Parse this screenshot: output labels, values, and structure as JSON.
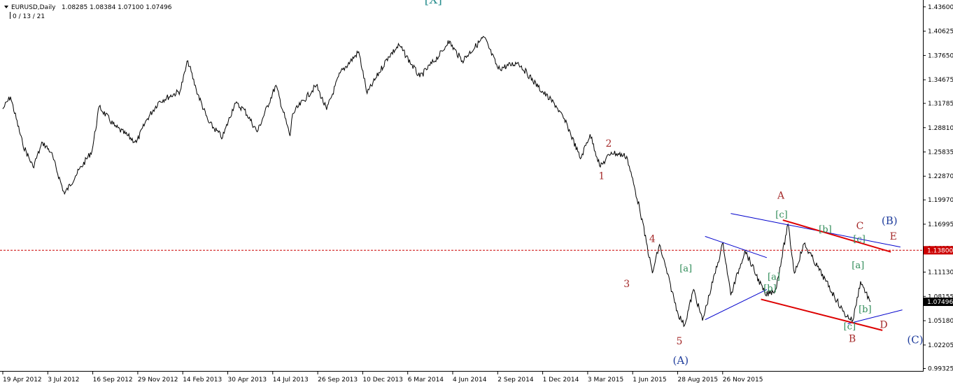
{
  "header": {
    "symbol": "EURUSD,Daily",
    "ohlc": "1.08285 1.08384 1.07100 1.07496",
    "counter": "0 / 13 / 21"
  },
  "chart_data": {
    "type": "line",
    "series": [
      {
        "values": [
          {
            "d": "2012-04-19",
            "v": 1.311
          },
          {
            "d": "2012-05-01",
            "v": 1.326
          },
          {
            "d": "2012-05-20",
            "v": 1.268
          },
          {
            "d": "2012-06-05",
            "v": 1.24
          },
          {
            "d": "2012-06-20",
            "v": 1.27
          },
          {
            "d": "2012-07-03",
            "v": 1.258
          },
          {
            "d": "2012-07-24",
            "v": 1.207
          },
          {
            "d": "2012-08-10",
            "v": 1.229
          },
          {
            "d": "2012-09-05",
            "v": 1.26
          },
          {
            "d": "2012-09-16",
            "v": 1.314
          },
          {
            "d": "2012-10-10",
            "v": 1.29
          },
          {
            "d": "2012-11-13",
            "v": 1.27
          },
          {
            "d": "2012-11-29",
            "v": 1.298
          },
          {
            "d": "2012-12-18",
            "v": 1.32
          },
          {
            "d": "2013-01-20",
            "v": 1.333
          },
          {
            "d": "2013-02-01",
            "v": 1.37
          },
          {
            "d": "2013-02-14",
            "v": 1.335
          },
          {
            "d": "2013-03-05",
            "v": 1.295
          },
          {
            "d": "2013-03-27",
            "v": 1.276
          },
          {
            "d": "2013-04-15",
            "v": 1.318
          },
          {
            "d": "2013-04-30",
            "v": 1.31
          },
          {
            "d": "2013-05-20",
            "v": 1.283
          },
          {
            "d": "2013-06-18",
            "v": 1.34
          },
          {
            "d": "2013-07-10",
            "v": 1.278
          },
          {
            "d": "2013-07-14",
            "v": 1.305
          },
          {
            "d": "2013-08-20",
            "v": 1.34
          },
          {
            "d": "2013-09-05",
            "v": 1.31
          },
          {
            "d": "2013-09-26",
            "v": 1.355
          },
          {
            "d": "2013-10-25",
            "v": 1.381
          },
          {
            "d": "2013-11-07",
            "v": 1.33
          },
          {
            "d": "2013-12-10",
            "v": 1.375
          },
          {
            "d": "2013-12-27",
            "v": 1.389
          },
          {
            "d": "2014-01-28",
            "v": 1.35
          },
          {
            "d": "2014-03-06",
            "v": 1.383
          },
          {
            "d": "2014-03-13",
            "v": 1.395
          },
          {
            "d": "2014-04-04",
            "v": 1.37
          },
          {
            "d": "2014-05-08",
            "v": 1.399
          },
          {
            "d": "2014-05-30",
            "v": 1.36
          },
          {
            "d": "2014-06-30",
            "v": 1.368
          },
          {
            "d": "2014-07-31",
            "v": 1.338
          },
          {
            "d": "2014-08-28",
            "v": 1.315
          },
          {
            "d": "2014-09-15",
            "v": 1.29
          },
          {
            "d": "2014-10-05",
            "v": 1.25
          },
          {
            "d": "2014-10-20",
            "v": 1.28
          },
          {
            "d": "2014-11-05",
            "v": 1.24
          },
          {
            "d": "2014-11-22",
            "v": 1.258
          },
          {
            "d": "2014-12-16",
            "v": 1.253
          },
          {
            "d": "2015-01-05",
            "v": 1.19
          },
          {
            "d": "2015-01-25",
            "v": 1.11
          },
          {
            "d": "2015-02-05",
            "v": 1.145
          },
          {
            "d": "2015-03-06",
            "v": 1.06
          },
          {
            "d": "2015-03-16",
            "v": 1.046
          },
          {
            "d": "2015-03-30",
            "v": 1.09
          },
          {
            "d": "2015-04-13",
            "v": 1.052
          },
          {
            "d": "2015-05-15",
            "v": 1.147
          },
          {
            "d": "2015-05-27",
            "v": 1.083
          },
          {
            "d": "2015-06-18",
            "v": 1.138
          },
          {
            "d": "2015-07-20",
            "v": 1.083
          },
          {
            "d": "2015-08-05",
            "v": 1.09
          },
          {
            "d": "2015-08-24",
            "v": 1.17
          },
          {
            "d": "2015-09-03",
            "v": 1.11
          },
          {
            "d": "2015-09-18",
            "v": 1.146
          },
          {
            "d": "2015-10-22",
            "v": 1.1
          },
          {
            "d": "2015-11-20",
            "v": 1.06
          },
          {
            "d": "2015-12-03",
            "v": 1.052
          },
          {
            "d": "2015-12-15",
            "v": 1.1
          },
          {
            "d": "2015-12-30",
            "v": 1.075
          }
        ]
      }
    ],
    "x_ticks": [
      "19 Apr 2012",
      "3 Jul 2012",
      "16 Sep 2012",
      "29 Nov 2012",
      "14 Feb 2013",
      "30 Apr 2013",
      "14 Jul 2013",
      "26 Sep 2013",
      "10 Dec 2013",
      "6 Mar 2014",
      "4 Jun 2014",
      "2 Sep 2014",
      "1 Dec 2014",
      "3 Mar 2015",
      "1 Jun 2015",
      "28 Aug 2015",
      "26 Nov 2015"
    ],
    "y_ticks": [
      "1.43600",
      "1.40625",
      "1.37650",
      "1.34675",
      "1.31785",
      "1.28810",
      "1.25835",
      "1.22870",
      "1.19970",
      "1.16995",
      "1.14020",
      "1.11130",
      "1.08155",
      "1.05180",
      "1.02205",
      "0.99325"
    ],
    "ylim": [
      0.9903,
      1.4444
    ],
    "price_line": {
      "label": "1.13800",
      "value": 1.138,
      "color": "#cc0000"
    },
    "current_price": {
      "label": "1.07496",
      "value": 1.07496
    },
    "trend_lines": [
      {
        "color": "#0000cc",
        "from": {
          "d": "2015-05-27",
          "v": 1.183
        },
        "to": {
          "d": "2016-02-15",
          "v": 1.142
        }
      },
      {
        "color": "#0000cc",
        "from": {
          "d": "2015-04-17",
          "v": 1.053
        },
        "to": {
          "d": "2015-07-22",
          "v": 1.09
        }
      },
      {
        "color": "#0000cc",
        "from": {
          "d": "2015-04-17",
          "v": 1.155
        },
        "to": {
          "d": "2015-07-22",
          "v": 1.129
        }
      },
      {
        "color": "#0000cc",
        "from": {
          "d": "2015-11-25",
          "v": 1.048
        },
        "to": {
          "d": "2016-02-18",
          "v": 1.065
        }
      },
      {
        "color": "#dd0000",
        "from": {
          "d": "2015-08-16",
          "v": 1.175
        },
        "to": {
          "d": "2016-01-31",
          "v": 1.136
        }
      },
      {
        "color": "#dd0000",
        "from": {
          "d": "2015-07-13",
          "v": 1.078
        },
        "to": {
          "d": "2016-01-18",
          "v": 1.04
        }
      }
    ],
    "wave_labels": [
      {
        "text": "[X]",
        "d": "2014-02-18",
        "v": 1.44,
        "color": "#2a8f8f",
        "size": 17
      },
      {
        "text": "1",
        "d": "2014-11-07",
        "v": 1.225,
        "color": "#a52a2a",
        "size": 14
      },
      {
        "text": "2",
        "d": "2014-11-18",
        "v": 1.265,
        "color": "#a52a2a",
        "size": 14
      },
      {
        "text": "3",
        "d": "2014-12-16",
        "v": 1.093,
        "color": "#a52a2a",
        "size": 14
      },
      {
        "text": "4",
        "d": "2015-01-25",
        "v": 1.148,
        "color": "#a52a2a",
        "size": 14
      },
      {
        "text": "5",
        "d": "2015-03-08",
        "v": 1.023,
        "color": "#a52a2a",
        "size": 14
      },
      {
        "text": "(A)",
        "d": "2015-03-10",
        "v": 0.999,
        "color": "#1e3c9c",
        "size": 15
      },
      {
        "text": "[a]",
        "d": "2015-03-18",
        "v": 1.112,
        "color": "#2e8b57",
        "size": 13
      },
      {
        "text": "[b]",
        "d": "2015-07-27",
        "v": 1.088,
        "color": "#2e8b57",
        "size": 13
      },
      {
        "text": "[a]",
        "d": "2015-08-02",
        "v": 1.102,
        "color": "#2e8b57",
        "size": 13
      },
      {
        "text": "A",
        "d": "2015-08-13",
        "v": 1.201,
        "color": "#a52a2a",
        "size": 14
      },
      {
        "text": "[c]",
        "d": "2015-08-14",
        "v": 1.178,
        "color": "#2e8b57",
        "size": 13
      },
      {
        "text": "[b]",
        "d": "2015-10-21",
        "v": 1.16,
        "color": "#2e8b57",
        "size": 13
      },
      {
        "text": "[a]",
        "d": "2015-12-11",
        "v": 1.116,
        "color": "#2e8b57",
        "size": 13
      },
      {
        "text": "[b]",
        "d": "2015-12-22",
        "v": 1.062,
        "color": "#2e8b57",
        "size": 13
      },
      {
        "text": "[c]",
        "d": "2015-11-28",
        "v": 1.041,
        "color": "#2e8b57",
        "size": 13
      },
      {
        "text": "B",
        "d": "2015-12-02",
        "v": 1.026,
        "color": "#a52a2a",
        "size": 14
      },
      {
        "text": "C",
        "d": "2015-12-14",
        "v": 1.164,
        "color": "#a52a2a",
        "size": 14
      },
      {
        "text": "[c]",
        "d": "2015-12-13",
        "v": 1.148,
        "color": "#2e8b57",
        "size": 13
      },
      {
        "text": "(B)",
        "d": "2016-01-29",
        "v": 1.17,
        "color": "#1e3c9c",
        "size": 15
      },
      {
        "text": "E",
        "d": "2016-02-04",
        "v": 1.151,
        "color": "#a52a2a",
        "size": 14
      },
      {
        "text": "D",
        "d": "2016-01-20",
        "v": 1.043,
        "color": "#a52a2a",
        "size": 14
      },
      {
        "text": "(C)",
        "d": "2016-03-09",
        "v": 1.024,
        "color": "#1e3c9c",
        "size": 15
      }
    ]
  }
}
